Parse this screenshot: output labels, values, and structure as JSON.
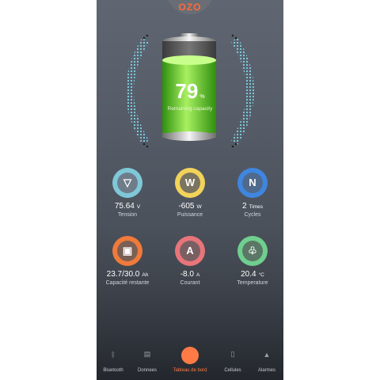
{
  "brand": {
    "logo_text": "OZO",
    "color": "#ff6a3d"
  },
  "battery": {
    "percent": "79",
    "percent_unit": "%",
    "percent_value": 79,
    "caption": "Remaining capacity"
  },
  "metrics": [
    {
      "value": "75.64",
      "unit": "V",
      "label": "Tension",
      "icon": "tension-icon",
      "glyph": "▽",
      "ring_color": "#7ec8d8",
      "inner_color": "#6f7d8a"
    },
    {
      "value": "-605",
      "unit": "W",
      "label": "Puissance",
      "icon": "power-icon",
      "glyph": "W",
      "ring_color": "#f2d35a",
      "inner_color": "#7a7460"
    },
    {
      "value": "2",
      "unit": "Times",
      "label": "Cycles",
      "icon": "cycles-icon",
      "glyph": "N",
      "ring_color": "#3f86e0",
      "inner_color": "#4f6a8c"
    },
    {
      "value": "23.7/30.0",
      "unit": "Ah",
      "label": "Capacité restante",
      "icon": "capacity-icon",
      "glyph": "▣",
      "ring_color": "#f07a3a",
      "inner_color": "#7a5f55"
    },
    {
      "value": "-8.0",
      "unit": "A",
      "label": "Courant",
      "icon": "current-icon",
      "glyph": "A",
      "ring_color": "#e8757a",
      "inner_color": "#7a5f62"
    },
    {
      "value": "20.4",
      "unit": "°C",
      "label": "Temperature",
      "icon": "temperature-icon",
      "glyph": "♧",
      "ring_color": "#6fcf8f",
      "inner_color": "#5a7865"
    }
  ],
  "tabs": [
    {
      "label": "Bluetooth",
      "icon": "bluetooth-icon",
      "glyph": "ᛒ",
      "active": false
    },
    {
      "label": "Donnees",
      "icon": "data-icon",
      "glyph": "▤",
      "active": false
    },
    {
      "label": "Tableau de bord",
      "icon": "dashboard-icon",
      "glyph": "◔",
      "active": true
    },
    {
      "label": "Cellules",
      "icon": "cells-icon",
      "glyph": "▯",
      "active": false
    },
    {
      "label": "Alarmes",
      "icon": "alarm-icon",
      "glyph": "▲",
      "active": false
    }
  ]
}
